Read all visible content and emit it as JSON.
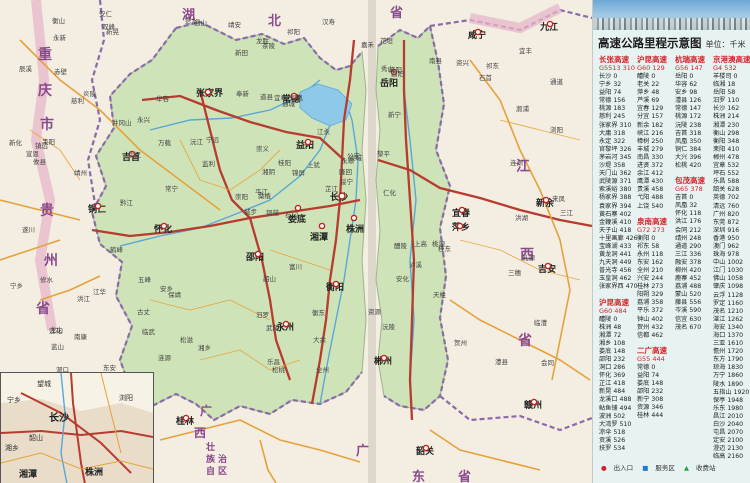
{
  "map": {
    "provinces": {
      "hubei": [
        "湖",
        "北",
        "省"
      ],
      "chongqing": [
        "重",
        "庆",
        "市"
      ],
      "guizhou": [
        "贵",
        "州",
        "省"
      ],
      "guangxi": [
        "广",
        "西",
        "壮",
        "族",
        "自",
        "治",
        "区"
      ],
      "guangdong": [
        "广",
        "东",
        "省"
      ],
      "jiangxi": [
        "江",
        "西",
        "省"
      ]
    },
    "cities": {
      "changsha": "长沙",
      "zhuzhou": "株洲",
      "xiangtan": "湘潭",
      "yueyang": "岳阳",
      "changde": "常德",
      "yiyang": "益阳",
      "loudi": "娄底",
      "shaoyang": "邵阳",
      "hengyang": "衡阳",
      "yongzhou": "永州",
      "chenzhou": "郴州",
      "huaihua": "怀化",
      "zhangjiajie": "张家界",
      "jishou": "吉首",
      "tongren": "铜仁",
      "guilin": "桂林",
      "pingxiang": "萍乡",
      "yichun": "宜春",
      "xinyu": "新余",
      "jian": "吉安",
      "ganzhou": "赣州",
      "shaoguan": "韶关",
      "xianning": "咸宁",
      "jiujiang": "九江"
    },
    "towns": [
      "石门",
      "慈利",
      "桑植",
      "龙山",
      "永顺",
      "保靖",
      "花垣",
      "凤凰",
      "麻阳",
      "芷江",
      "新晃",
      "会同",
      "靖州",
      "通道",
      "城步",
      "新宁",
      "东安",
      "道县",
      "江永",
      "江华",
      "宁远",
      "蓝山",
      "临武",
      "宜章",
      "汝城",
      "桂东",
      "炎陵",
      "茶陵",
      "攸县",
      "醴陵",
      "浏阳",
      "平江",
      "汨罗",
      "湘阴",
      "华容",
      "南县",
      "安乡",
      "澧县",
      "临澧",
      "桃源",
      "汉寿",
      "沅江",
      "桃江",
      "安化",
      "涟源",
      "新化",
      "隆回",
      "洞口",
      "武冈",
      "绥宁",
      "洪江",
      "溆浦",
      "辰溪",
      "泸溪",
      "沅陵",
      "古丈",
      "双峰",
      "衡山",
      "衡东",
      "祁东",
      "祁阳",
      "常宁",
      "耒阳",
      "永兴",
      "资兴",
      "安仁",
      "嘉禾",
      "新田",
      "桂阳",
      "宁乡",
      "韶山",
      "湘乡",
      "上高",
      "万载",
      "莲花",
      "永新",
      "井冈山",
      "遂川",
      "崇义",
      "大余",
      "上犹",
      "南康",
      "仁化",
      "乳源",
      "乐昌",
      "连州",
      "富川",
      "贺州",
      "全州",
      "资源",
      "龙胜",
      "三江",
      "黎平",
      "天柱",
      "锦屏",
      "三穗",
      "镇远",
      "松桃",
      "秀山",
      "酉阳",
      "黔江",
      "彭水",
      "来凤",
      "宣恩",
      "鹤峰",
      "五峰",
      "松滋",
      "公安",
      "石首",
      "监利",
      "洪湖",
      "赤壁",
      "通城",
      "崇阳",
      "通山",
      "修水",
      "铜鼓",
      "宜丰",
      "奉新",
      "靖安"
    ],
    "inset_labels": [
      "长沙",
      "株洲",
      "湘潭",
      "宁乡",
      "浏阳",
      "望城",
      "湘乡",
      "韶山"
    ]
  },
  "panel": {
    "title": "高速公路里程示意图",
    "unit": "单位：千米",
    "columns": [
      {
        "sections": [
          {
            "name": "长张高速",
            "code": "G5513",
            "length": "310",
            "rows": [
              "长沙 0",
              "宁乡 32",
              "益阳 74",
              "常德 156",
              "桃源 183",
              "慈利 245",
              "张家界 310",
              "大庸 318",
              "永定 322",
              "官黎坪 326",
              "茅岩河 345",
              "沙堤 358",
              "天门山 362",
              "武陵源 371",
              "索溪峪 380",
              "杨家界 388",
              "袁家界 394",
              "黄石寨 402",
              "金鞭溪 410",
              "天子山 418",
              "十里画廊 426",
              "宝峰湖 433",
              "黄龙洞 441",
              "九天洞 449",
              "普光寺 456",
              "玉皇洞 462",
              "张家界西 470"
            ]
          },
          {
            "name": "沪昆高速",
            "code": "G60",
            "length": "484",
            "rows": [
              "醴陵 0",
              "株洲 48",
              "湘潭 72",
              "湘乡 108",
              "娄底 148",
              "邵阳 232",
              "洞口 286",
              "怀化 369",
              "芷江 418",
              "新晃 484",
              "龙溪口 488",
              "鲇鱼铺 494",
              "波洲 502",
              "大湾罗 510",
              "凉伞 518",
              "贡溪 526",
              "扶罗 534"
            ]
          }
        ]
      },
      {
        "sections": [
          {
            "name": "沪昆高速",
            "code": "G60",
            "length": "129",
            "rows": [
              "醴陵 0",
              "老关 22",
              "萍乡 48",
              "芦溪 69",
              "宜春 129",
              "分宜 157",
              "新余 182",
              "峡江 216",
              "樟树 250",
              "丰城 279",
              "南昌 330",
              "进贤 372",
              "余江 412",
              "鹰潭 430",
              "贵溪 458",
              "弋阳 488",
              "上饶 540"
            ]
          },
          {
            "name": "泉南高速",
            "code": "G72",
            "length": "273",
            "rows": [
              "衡阳 0",
              "祁东 58",
              "永州 118",
              "东安 162",
              "全州 210",
              "兴安 244",
              "桂林 273",
              "阳朔 329",
              "荔浦 358",
              "平乐 372",
              "钟山 402",
              "贺州 432",
              "信都 462"
            ]
          },
          {
            "name": "二广高速",
            "code": "G55",
            "length": "444",
            "rows": [
              "常德 0",
              "益阳 74",
              "娄底 148",
              "邵阳 232",
              "新宁 308",
              "资源 346",
              "桂林 444"
            ]
          }
        ]
      },
      {
        "sections": [
          {
            "name": "杭瑞高速",
            "code": "G56",
            "length": "147",
            "rows": [
              "岳阳 0",
              "华容 62",
              "安乡 98",
              "澧县 126",
              "常德 147",
              "桃源 172",
              "沅陵 238",
              "吉首 318",
              "凤凰 350",
              "铜仁 384",
              "大兴 396",
              "松桃 420"
            ]
          },
          {
            "name": "包茂高速",
            "code": "G65",
            "length": "378",
            "rows": [
              "吉首 0",
              "凤凰 32",
              "怀化 118",
              "洪江 176",
              "会同 212",
              "靖州 248",
              "通道 290",
              "三江 336",
              "融安 378",
              "柳州 420",
              "鹿寨 452",
              "荔浦 488",
              "蒙山 520",
              "藤县 556",
              "岑溪 590",
              "信宜 630",
              "茂名 670"
            ]
          }
        ]
      },
      {
        "sections": [
          {
            "name": "京港澳高速",
            "code": "G4",
            "length": "532",
            "rows": [
              "羊楼司 0",
              "临湘 18",
              "岳阳 58",
              "汨罗 110",
              "长沙 162",
              "株洲 214",
              "湘潭 230",
              "衡山 298",
              "衡阳 348",
              "耒阳 410",
              "郴州 478",
              "宜章 532",
              "坪石 552",
              "乐昌 588",
              "韶关 628",
              "英德 702",
              "清远 760",
              "广州 820",
              "东莞 872",
              "深圳 916",
              "香港 950",
              "澳门 962",
              "珠海 978",
              "中山 1002",
              "江门 1030",
              "佛山 1058",
              "肇庆 1098",
              "云浮 1128",
              "罗定 1160",
              "茂名 1210",
              "湛江 1262",
              "海安 1340",
              "海口 1370",
              "三亚 1610",
              "儋州 1720",
              "东方 1790",
              "琼海 1830",
              "万宁 1860",
              "陵水 1890",
              "五指山 1920",
              "保亭 1948",
              "乐东 1980",
              "昌江 2010",
              "白沙 2040",
              "屯昌 2070",
              "定安 2100",
              "澄迈 2130",
              "临高 2160"
            ]
          }
        ]
      }
    ],
    "legend": [
      "出入口",
      "服务区",
      "收费站"
    ]
  }
}
